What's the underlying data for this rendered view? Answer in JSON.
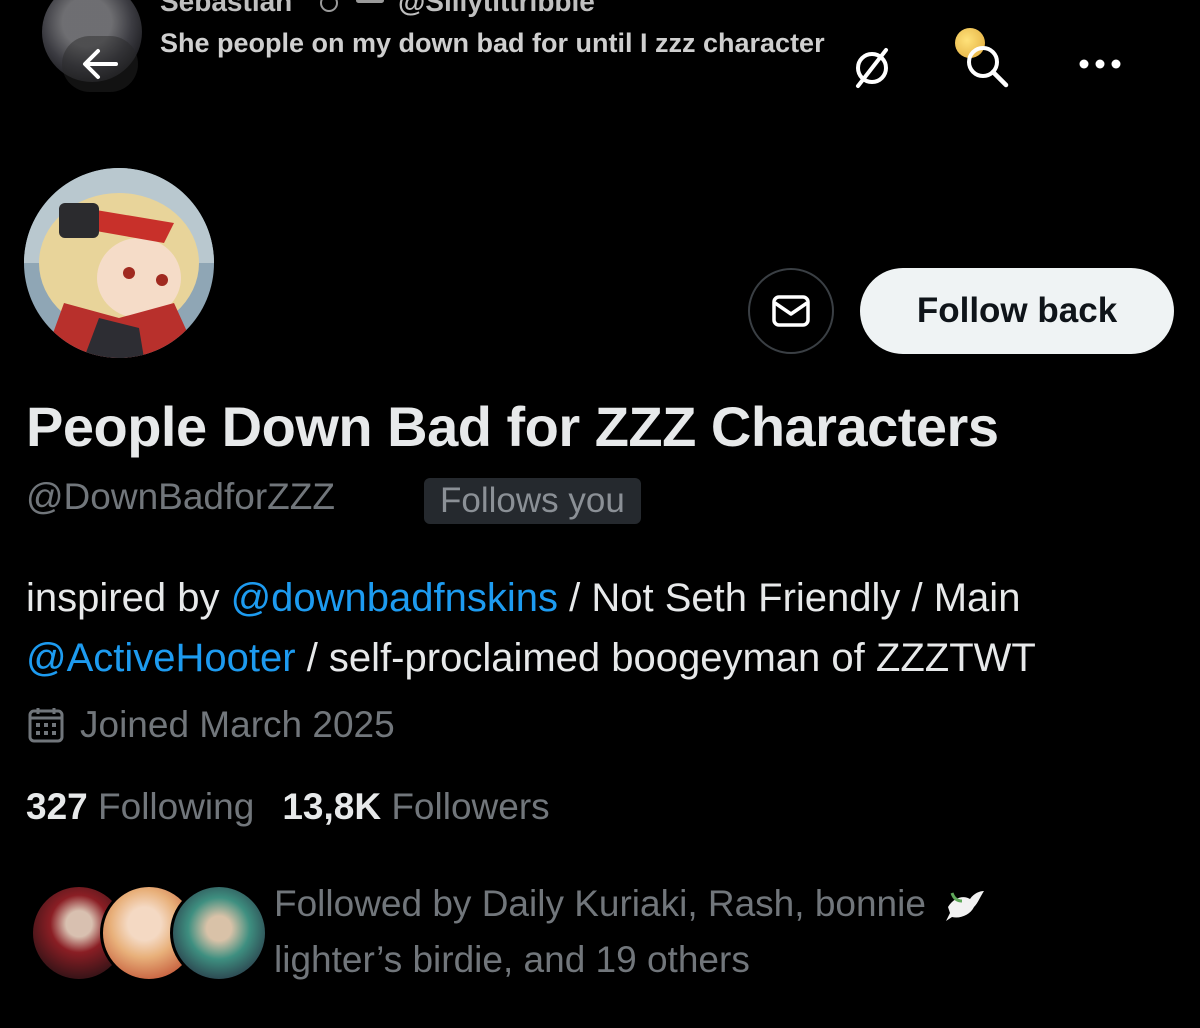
{
  "banner": {
    "name": "Sebastian",
    "handle": "@Sillytittribble",
    "tweet_text": "She people on my down bad for until I zzz character"
  },
  "header": {
    "back_icon": "arrow-left-icon",
    "translate_icon": "globe-strikethrough-icon",
    "search_icon": "search-icon",
    "more_icon": "more-horizontal-icon"
  },
  "profile": {
    "display_name": "People Down Bad for ZZZ Characters",
    "handle": "@DownBadforZZZ",
    "follows_you_badge": "Follows you",
    "follow_button_label": "Follow back",
    "message_icon": "envelope-icon",
    "bio": {
      "part1": "inspired by ",
      "mention1": "@downbadfnskins",
      "part2": " / Not Seth Friendly / Main ",
      "mention2": "@ActiveHooter",
      "part3": " / self-proclaimed boogeyman of ZZZTWT"
    },
    "joined": "Joined March 2025",
    "following_count": "327",
    "following_label": "Following",
    "followers_count": "13,8K",
    "followers_label": "Followers",
    "followed_by_line1": "Followed by Daily Kuriaki, Rash, bonnie",
    "followed_by_line2": "lighter’s birdie, and 19 others"
  },
  "colors": {
    "background": "#000000",
    "text_primary": "#e7e9ea",
    "text_secondary": "#71767b",
    "link": "#1d9bf0",
    "button_bg": "#eff3f4",
    "button_text": "#0f1419"
  }
}
